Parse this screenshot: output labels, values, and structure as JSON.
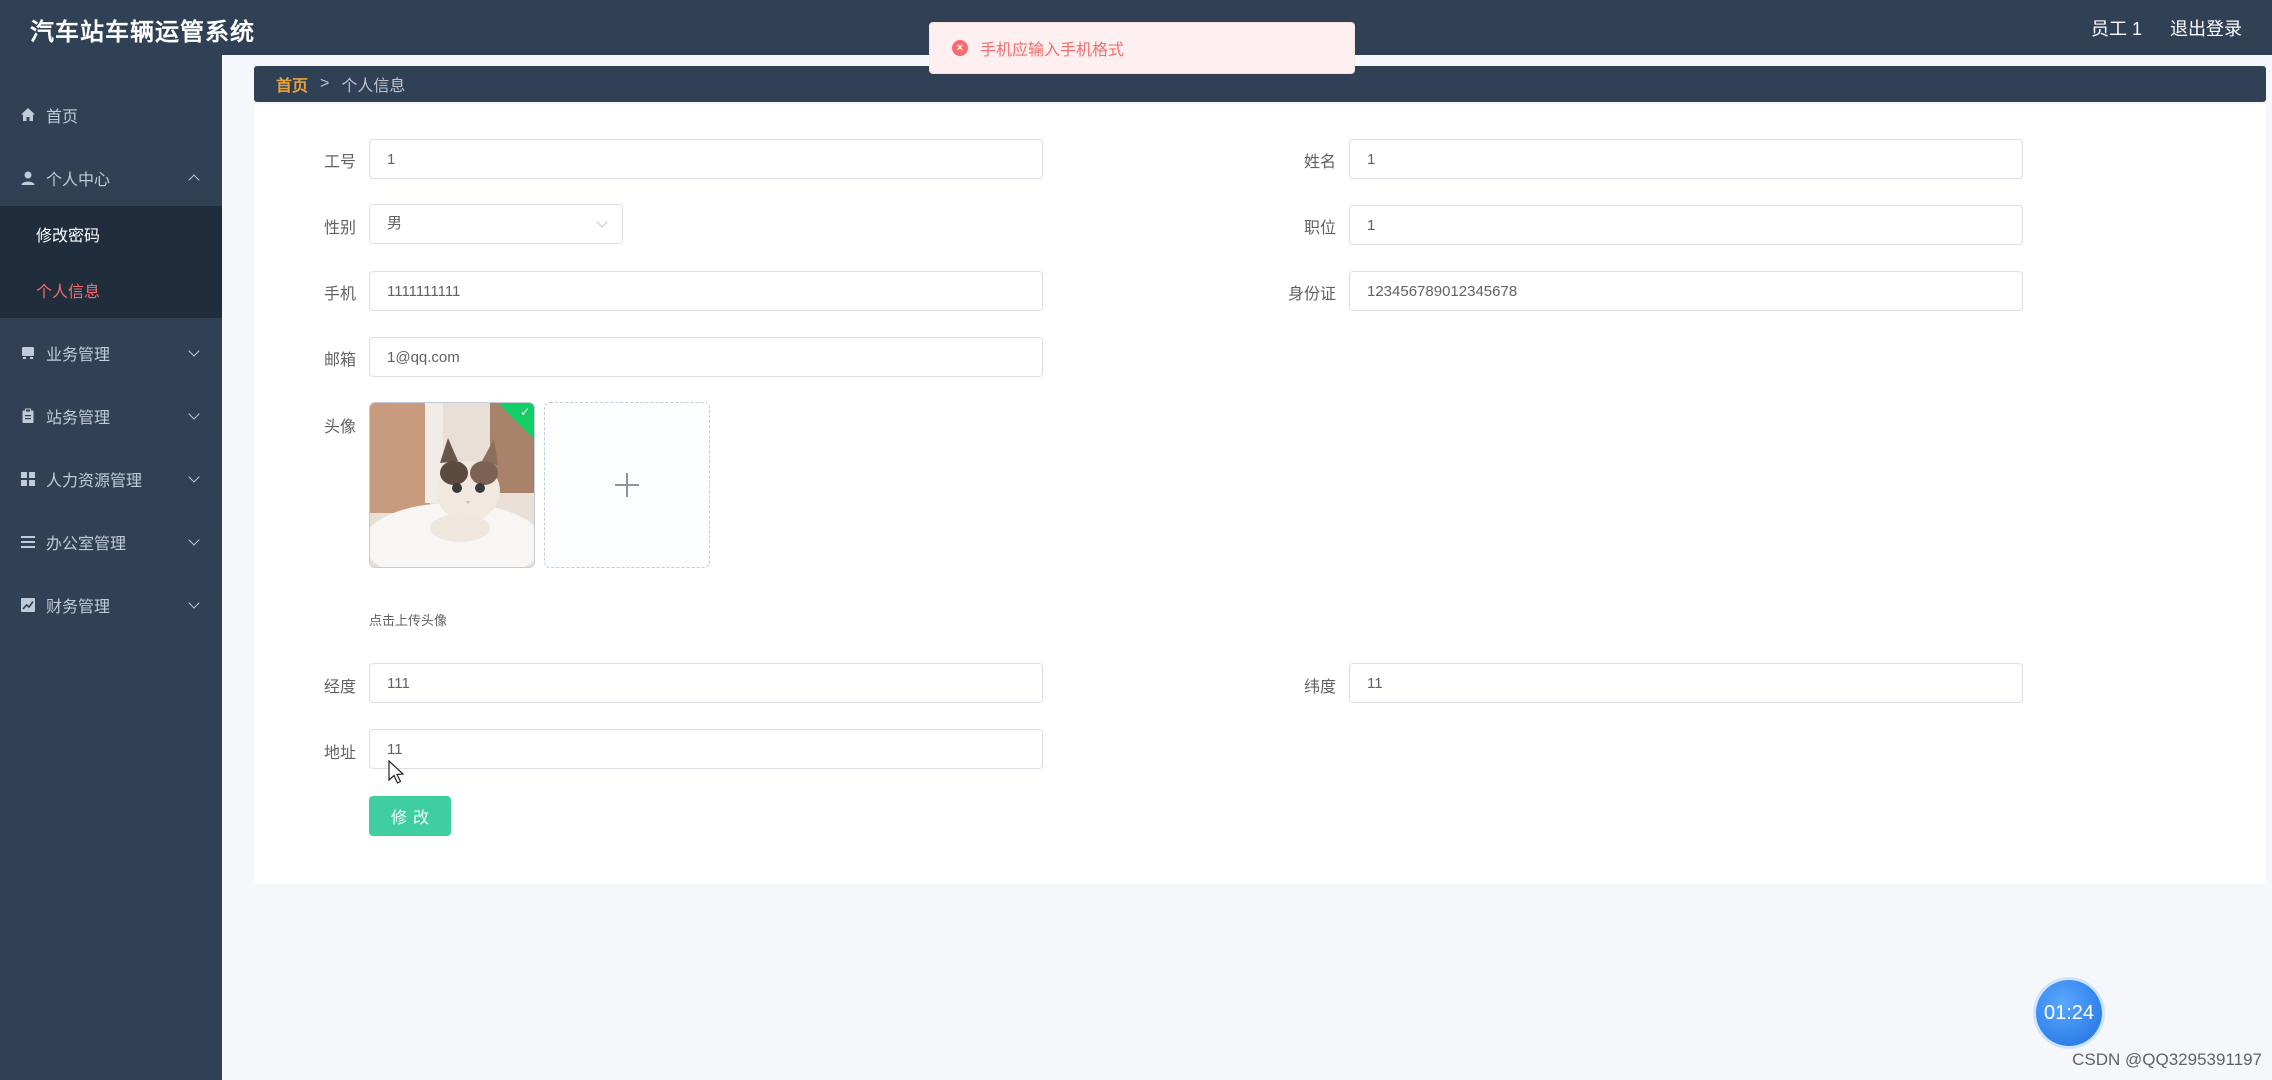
{
  "header": {
    "app_title": "汽车站车辆运管系统",
    "user_label": "员工 1",
    "logout_label": "退出登录"
  },
  "sidebar": {
    "items": [
      {
        "label": "首页",
        "icon": "home-icon"
      },
      {
        "label": "个人中心",
        "icon": "user-icon",
        "expanded": true
      },
      {
        "label": "修改密码"
      },
      {
        "label": "个人信息",
        "active": true
      },
      {
        "label": "业务管理",
        "icon": "bus-icon"
      },
      {
        "label": "站务管理",
        "icon": "clipboard-icon"
      },
      {
        "label": "人力资源管理",
        "icon": "grid-icon"
      },
      {
        "label": "办公室管理",
        "icon": "list-icon"
      },
      {
        "label": "财务管理",
        "icon": "chart-icon"
      }
    ]
  },
  "breadcrumb": {
    "home": "首页",
    "separator": ">",
    "current": "个人信息"
  },
  "form": {
    "job_no": {
      "label": "工号",
      "value": "1"
    },
    "name": {
      "label": "姓名",
      "value": "1"
    },
    "gender": {
      "label": "性别",
      "value": "男"
    },
    "position": {
      "label": "职位",
      "value": "1"
    },
    "phone": {
      "label": "手机",
      "value": "1111111111"
    },
    "id_card": {
      "label": "身份证",
      "value": "123456789012345678"
    },
    "email": {
      "label": "邮箱",
      "value": "1@qq.com"
    },
    "avatar": {
      "label": "头像",
      "upload_tip": "点击上传头像"
    },
    "longitude": {
      "label": "经度",
      "value": "111"
    },
    "latitude": {
      "label": "纬度",
      "value": "11"
    },
    "address": {
      "label": "地址",
      "value": "11"
    },
    "submit_label": "修改"
  },
  "toast": {
    "message": "手机应输入手机格式",
    "type": "error"
  },
  "timer": "01:24",
  "watermark": "CSDN @QQ3295391197",
  "colors": {
    "sidebar_bg": "#304156",
    "accent_active": "#f56c6c",
    "submit_button": "#3ecea0",
    "breadcrumb_home": "#e6a23c"
  }
}
